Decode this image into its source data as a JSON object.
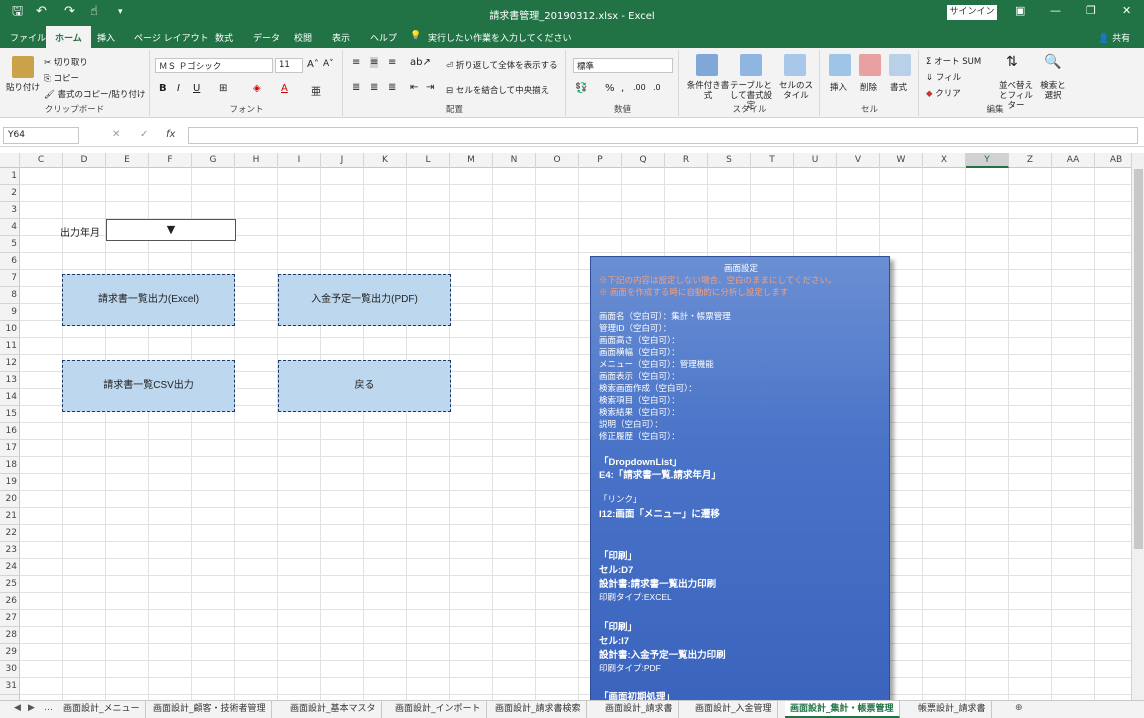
{
  "titlebar": {
    "title": "請求書管理_20190312.xlsx  -  Excel",
    "signin": "サインイン",
    "qat": [
      "save-icon",
      "undo-icon",
      "redo-icon",
      "touch-icon",
      "customize-icon"
    ]
  },
  "ribbon_tabs": [
    "ファイル",
    "ホーム",
    "挿入",
    "ページ レイアウト",
    "数式",
    "データ",
    "校閲",
    "表示",
    "ヘルプ"
  ],
  "tellme": "実行したい作業を入力してください",
  "share": "共有",
  "ribbon": {
    "clipboard": {
      "paste": "貼り付け",
      "cut": "切り取り",
      "copy": "コピー",
      "format_painter": "書式のコピー/貼り付け",
      "label": "クリップボード"
    },
    "font": {
      "name": "ＭＳ Ｐゴシック",
      "size": "11",
      "label": "フォント"
    },
    "alignment": {
      "wrap": "折り返して全体を表示する",
      "merge": "セルを結合して中央揃え",
      "label": "配置"
    },
    "number": {
      "format": "標準",
      "label": "数値"
    },
    "styles": {
      "conditional": "条件付き書式",
      "table": "テーブルとして書式設定",
      "cell": "セルのスタイル",
      "label": "スタイル"
    },
    "cells": {
      "insert": "挿入",
      "delete": "削除",
      "format": "書式",
      "label": "セル"
    },
    "editing": {
      "autosum": "オート SUM",
      "fill": "フィル",
      "clear": "クリア",
      "sort": "並べ替えとフィルター",
      "find": "検索と選択",
      "label": "編集"
    }
  },
  "formula_bar": {
    "namebox": "Y64",
    "fx": "fx",
    "value": ""
  },
  "columns": [
    "C",
    "D",
    "E",
    "F",
    "G",
    "H",
    "I",
    "J",
    "K",
    "L",
    "M",
    "N",
    "O",
    "P",
    "Q",
    "R",
    "S",
    "T",
    "U",
    "V",
    "W",
    "X",
    "Y",
    "Z",
    "AA",
    "AB"
  ],
  "selected_column": "Y",
  "rows": [
    "1",
    "2",
    "3",
    "4",
    "5",
    "6",
    "7",
    "8",
    "9",
    "10",
    "11",
    "12",
    "13",
    "14",
    "15",
    "16",
    "17",
    "18",
    "19",
    "20",
    "21",
    "22",
    "23",
    "24",
    "25",
    "26",
    "27",
    "28",
    "29",
    "30",
    "31"
  ],
  "sheet": {
    "label_year_month": "出力年月",
    "dropdown_arrow": "▼",
    "btn_invoice_excel": "請求書一覧出力(Excel)",
    "btn_payment_pdf": "入金予定一覧出力(PDF)",
    "btn_invoice_csv": "請求書一覧CSV出力",
    "btn_back": "戻る"
  },
  "note": {
    "title": "画面設定",
    "warn1": "※下記の内容は設定しない場合、空白のままにしてください。",
    "warn2": "※ 画面を作成する時に自動的に分析し設定します",
    "lines": [
      "画面名（空白可）：集計・帳票管理",
      "管理ID（空白可）：",
      "画面高さ（空白可）：",
      "画面横幅（空白可）：",
      "メニュー（空白可）：管理機能",
      "画面表示（空白可）：",
      "検索画面作成（空白可）：",
      "検索項目（空白可）：",
      "検索結果（空白可）：",
      "説明（空白可）：",
      "修正履歴（空白可）："
    ],
    "dropdown_head": "「DropdownList」",
    "dropdown_line": "E4:「請求書一覧.請求年月」",
    "link_head": "「リンク」",
    "link_line": "I12:画面「メニュー」に遷移",
    "print1_head": "「印刷」",
    "print1_cell": "セル:D7",
    "print1_doc": "設計書:請求書一覧出力印刷",
    "print1_type": "印刷タイプ:EXCEL",
    "print2_head": "「印刷」",
    "print2_cell": "セル:I7",
    "print2_doc": "設計書:入金予定一覧出力印刷",
    "print2_type": "印刷タイプ:PDF",
    "init_head": "「画面初期処理」"
  },
  "sheet_tabs": [
    "画面設計_メニュー",
    "画面設計_顧客・技術者管理",
    "画面設計_基本マスタ",
    "画面設計_インポート",
    "画面設計_請求書検索",
    "画面設計_請求書",
    "画面設計_入金管理",
    "画面設計_集計・帳票管理",
    "帳票設計_請求書"
  ],
  "active_sheet_tab": "画面設計_集計・帳票管理"
}
